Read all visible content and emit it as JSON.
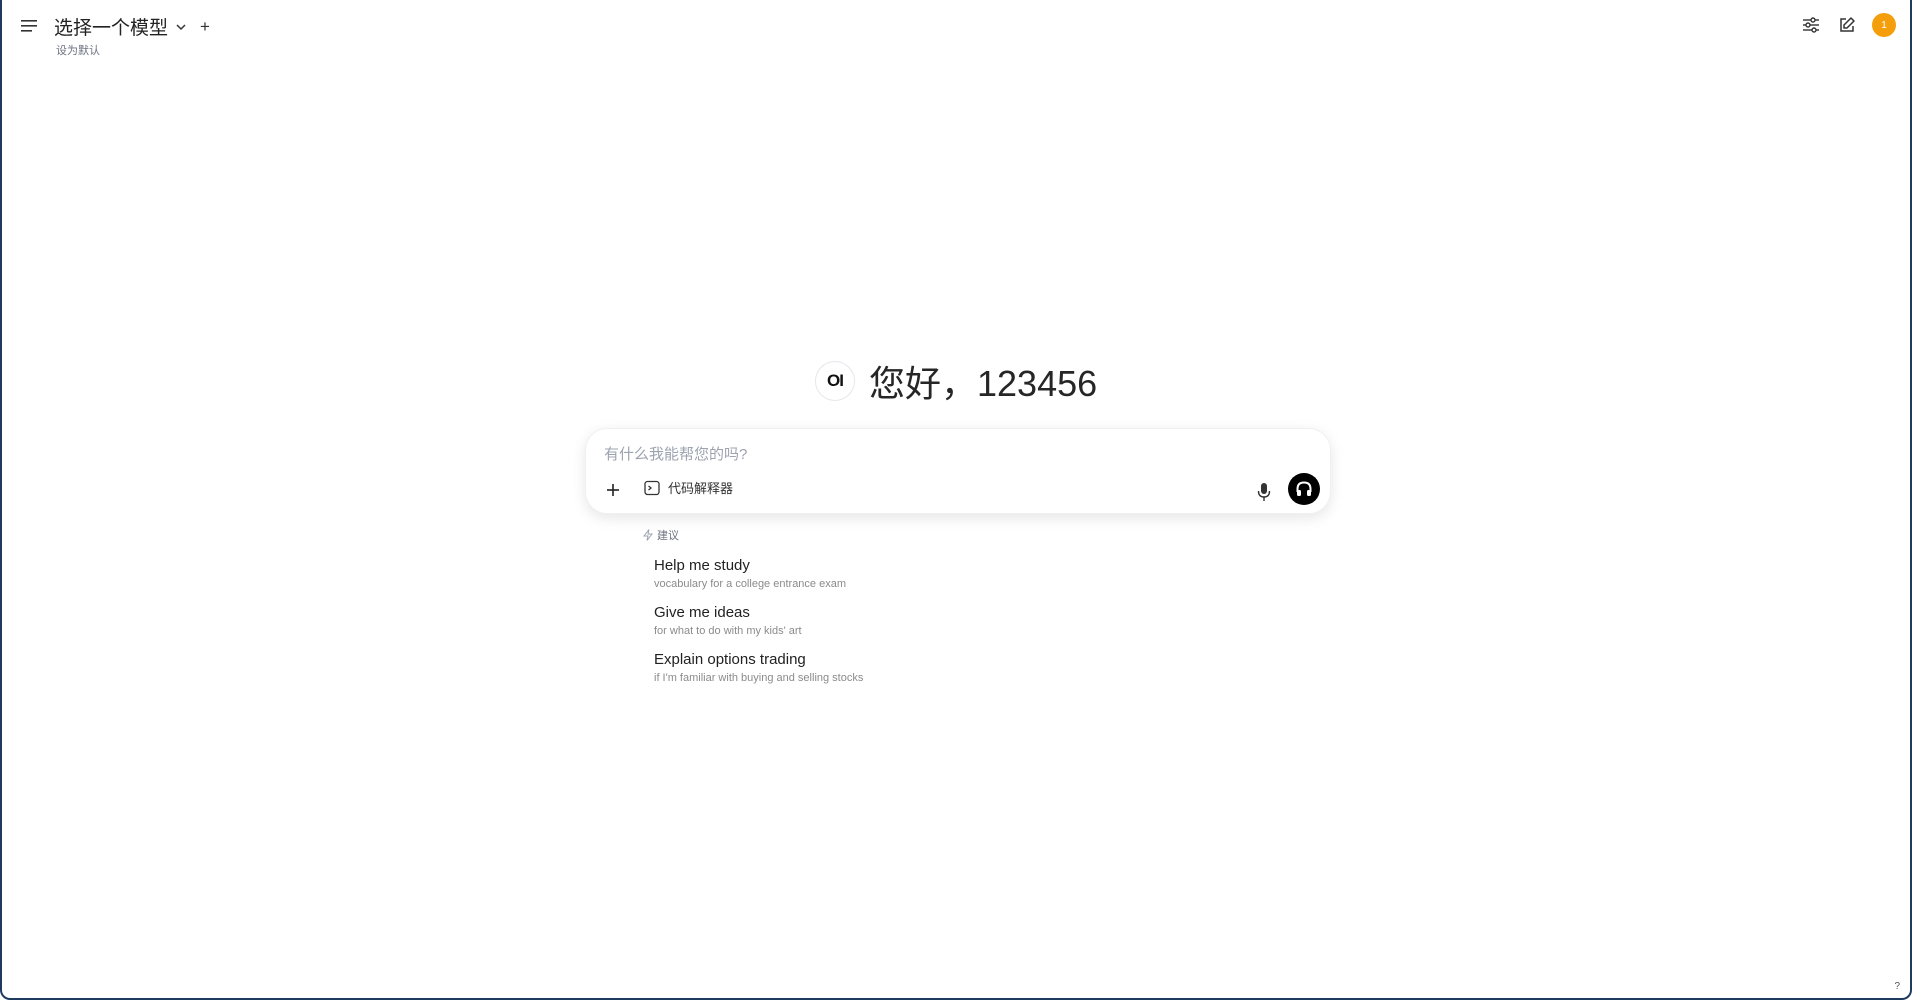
{
  "header": {
    "model_title": "选择一个模型",
    "add_model": "+",
    "set_default": "设为默认",
    "avatar_text": "1",
    "avatar_color": "#f59e0b"
  },
  "greeting": {
    "logo": "OI",
    "text": "您好，123456"
  },
  "composer": {
    "placeholder": "有什么我能帮您的吗?",
    "value": "",
    "tool_label": "代码解释器"
  },
  "suggestions": {
    "header": "建议",
    "items": [
      {
        "title": "Help me study",
        "subtitle": "vocabulary for a college entrance exam"
      },
      {
        "title": "Give me ideas",
        "subtitle": "for what to do with my kids' art"
      },
      {
        "title": "Explain options trading",
        "subtitle": "if I'm familiar with buying and selling stocks"
      }
    ]
  },
  "help": "?",
  "icons": {
    "menu": "menu-icon",
    "chevron": "chevron-down-icon",
    "controls": "sliders-icon",
    "new_chat": "edit-icon",
    "plus": "plus-icon",
    "terminal": "terminal-icon",
    "mic": "mic-icon",
    "voice": "headphones-icon",
    "suggest": "bolt-icon"
  }
}
